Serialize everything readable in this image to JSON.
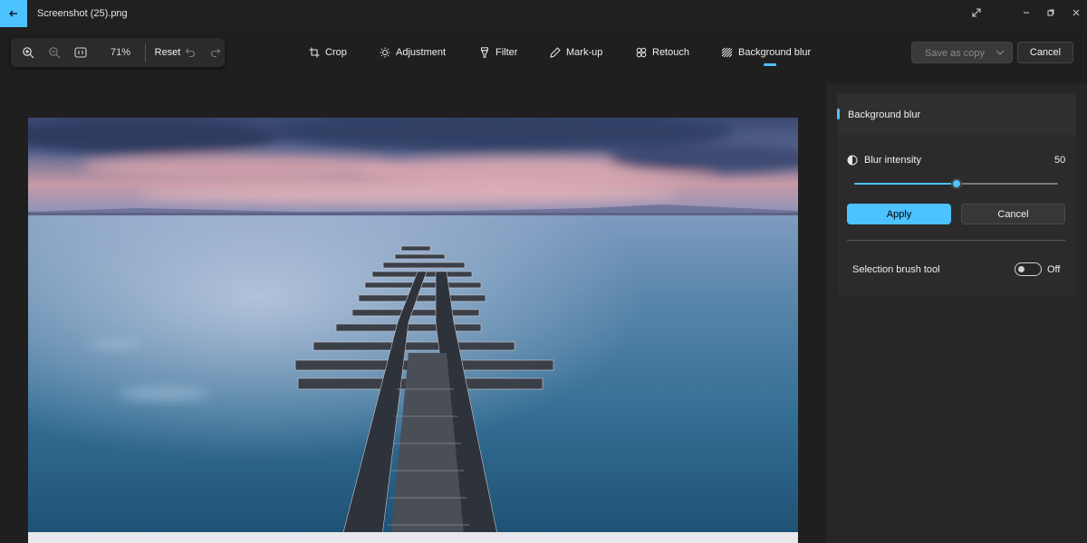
{
  "window": {
    "title": "Screenshot (25).png",
    "back_icon": "arrow-left-icon",
    "expand_icon": "expand-diagonal-icon",
    "minimize_icon": "minimize-icon",
    "restore_icon": "restore-icon",
    "close_icon": "close-icon"
  },
  "zoombar": {
    "zoom_in_icon": "zoom-in-icon",
    "zoom_out_icon": "zoom-out-icon",
    "fit_icon": "actual-size-icon",
    "zoom_level": "71%",
    "reset_label": "Reset",
    "undo_icon": "undo-icon",
    "redo_icon": "redo-icon"
  },
  "tools": [
    {
      "label": "Crop",
      "icon": "crop-icon"
    },
    {
      "label": "Adjustment",
      "icon": "brightness-icon"
    },
    {
      "label": "Filter",
      "icon": "filter-icon"
    },
    {
      "label": "Mark-up",
      "icon": "pen-icon"
    },
    {
      "label": "Retouch",
      "icon": "retouch-icon"
    },
    {
      "label": "Background blur",
      "icon": "background-blur-icon",
      "active": true
    }
  ],
  "actions": {
    "save_as_copy": "Save as copy",
    "cancel": "Cancel"
  },
  "panel": {
    "title": "Background blur",
    "intensity_label": "Blur intensity",
    "intensity_value": "50",
    "intensity_fraction": 0.5,
    "apply": "Apply",
    "cancel": "Cancel",
    "brush_label": "Selection brush tool",
    "brush_state": "Off"
  },
  "colors": {
    "accent": "#4cc2ff",
    "background": "#1f1f1f",
    "panel": "#2b2b2b"
  }
}
